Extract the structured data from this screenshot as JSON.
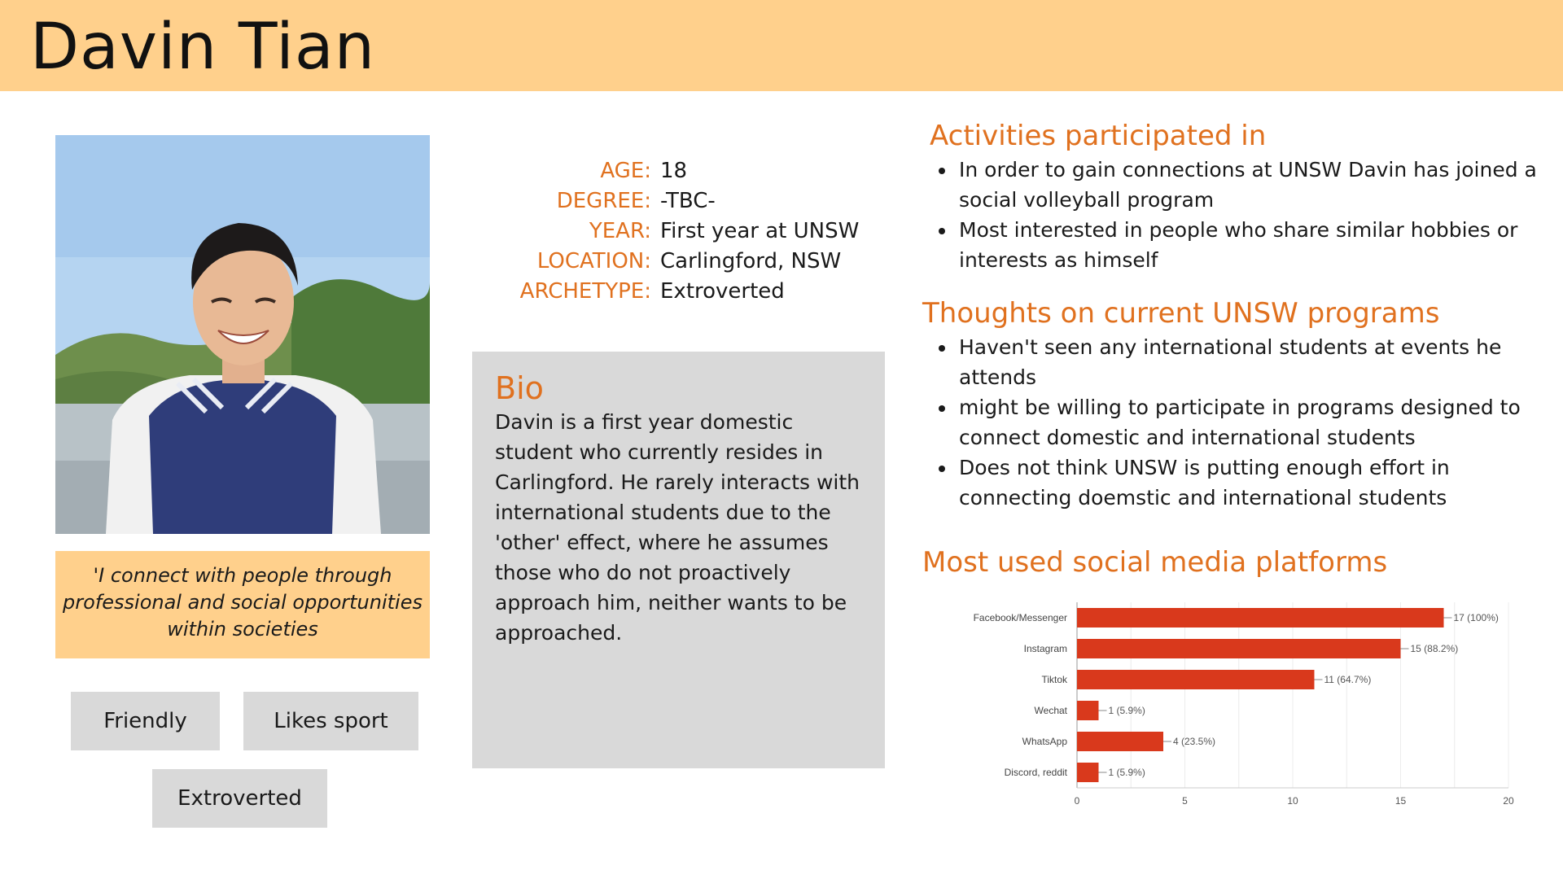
{
  "header": {
    "name": "Davin Tian"
  },
  "quote": "'I connect with people through professional and social opportunities within societies",
  "tags": [
    "Friendly",
    "Likes sport",
    "Extroverted"
  ],
  "info": [
    {
      "label": "AGE:",
      "value": "18"
    },
    {
      "label": "DEGREE:",
      "value": "-TBC-"
    },
    {
      "label": "YEAR:",
      "value": "First year at UNSW"
    },
    {
      "label": "LOCATION:",
      "value": "Carlingford, NSW"
    },
    {
      "label": "ARCHETYPE:",
      "value": "Extroverted"
    }
  ],
  "bio": {
    "title": "Bio",
    "text": "Davin is a first year domestic student who currently resides in Carlingford. He rarely interacts with international students due to the 'other' effect, where he assumes those who do not proactively approach him, neither wants to be approached."
  },
  "activities": {
    "title": "Activities participated in",
    "items": [
      "In order to gain connections at UNSW Davin has joined a social volleyball program",
      "Most interested in people who share similar hobbies or interests as himself"
    ]
  },
  "thoughts": {
    "title": "Thoughts on current UNSW programs",
    "items": [
      "Haven't seen any international students at events he attends",
      "might be willing to participate in programs designed to connect domestic and international students",
      "Does not think UNSW is putting enough effort in connecting doemstic and international students"
    ]
  },
  "social": {
    "title": "Most used social media platforms"
  },
  "colors": {
    "accent": "#e0711f",
    "header_bg": "#ffd08c",
    "panel_bg": "#d9d9d9",
    "bar": "#d9391c"
  },
  "chart_data": {
    "type": "bar",
    "orientation": "horizontal",
    "categories": [
      "Facebook/Messenger",
      "Instagram",
      "Tiktok",
      "Wechat",
      "WhatsApp",
      "Discord, reddit"
    ],
    "values": [
      17,
      15,
      11,
      1,
      4,
      1
    ],
    "data_labels": [
      "17 (100%)",
      "15 (88.2%)",
      "11 (64.7%)",
      "1 (5.9%)",
      "4 (23.5%)",
      "1 (5.9%)"
    ],
    "xlim": [
      0,
      20
    ],
    "xticks": [
      0,
      5,
      10,
      15,
      20
    ],
    "grid": true,
    "legend": "none"
  }
}
